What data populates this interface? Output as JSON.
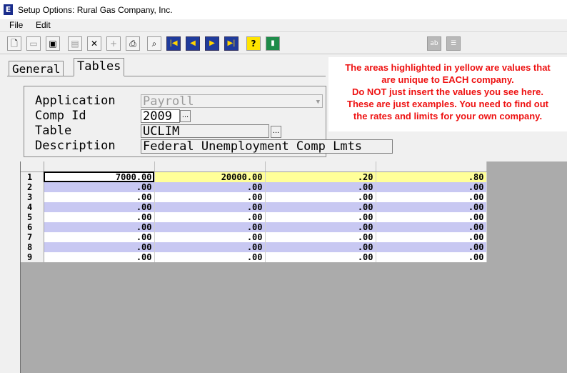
{
  "window": {
    "title": "Setup Options: Rural Gas Company, Inc.",
    "icon": "app-icon"
  },
  "menu": {
    "file": "File",
    "edit": "Edit"
  },
  "toolbar": {
    "buttons": [
      {
        "name": "new-icon",
        "glyph": "🗋"
      },
      {
        "name": "open-icon",
        "glyph": "📂"
      },
      {
        "name": "save-icon",
        "glyph": "💾"
      },
      {
        "name": "list-icon",
        "glyph": "▤"
      },
      {
        "name": "delete-icon",
        "glyph": "✕"
      },
      {
        "name": "add-icon",
        "glyph": "+"
      },
      {
        "name": "print-icon",
        "glyph": "⎙"
      },
      {
        "name": "find-icon",
        "glyph": "⌕"
      },
      {
        "name": "first-record-icon",
        "glyph": "|◀"
      },
      {
        "name": "previous-record-icon",
        "glyph": "◀"
      },
      {
        "name": "next-record-icon",
        "glyph": "▶"
      },
      {
        "name": "last-record-icon",
        "glyph": "▶|"
      },
      {
        "name": "help-icon",
        "glyph": "?"
      },
      {
        "name": "exit-icon",
        "glyph": "▮"
      },
      {
        "name": "abc-icon",
        "glyph": "ab"
      },
      {
        "name": "settings-icon",
        "glyph": "☰"
      }
    ]
  },
  "tabs": {
    "general": "General",
    "tables": "Tables"
  },
  "note": {
    "line1": "The areas highlighted in yellow are values that",
    "line2": "are unique to EACH company.",
    "line3": "Do NOT just insert the values you see here.",
    "line4": "These are just examples.  You need to find out",
    "line5": "the rates and limits for your own company."
  },
  "form": {
    "application_label": "Application",
    "application_value": "Payroll",
    "compid_label": "Comp Id",
    "compid_value": "2009",
    "table_label": "Table",
    "table_value": "UCLIM",
    "description_label": "Description",
    "description_value": "Federal Unemployment Comp Lmts",
    "ellipsis": "..."
  },
  "grid": {
    "rows": [
      {
        "num": "1",
        "c1": "7000.00",
        "c2": "20000.00",
        "c3": ".20",
        "c4": ".80"
      },
      {
        "num": "2",
        "c1": ".00",
        "c2": ".00",
        "c3": ".00",
        "c4": ".00"
      },
      {
        "num": "3",
        "c1": ".00",
        "c2": ".00",
        "c3": ".00",
        "c4": ".00"
      },
      {
        "num": "4",
        "c1": ".00",
        "c2": ".00",
        "c3": ".00",
        "c4": ".00"
      },
      {
        "num": "5",
        "c1": ".00",
        "c2": ".00",
        "c3": ".00",
        "c4": ".00"
      },
      {
        "num": "6",
        "c1": ".00",
        "c2": ".00",
        "c3": ".00",
        "c4": ".00"
      },
      {
        "num": "7",
        "c1": ".00",
        "c2": ".00",
        "c3": ".00",
        "c4": ".00"
      },
      {
        "num": "8",
        "c1": ".00",
        "c2": ".00",
        "c3": ".00",
        "c4": ".00"
      },
      {
        "num": "9",
        "c1": ".00",
        "c2": ".00",
        "c3": ".00",
        "c4": ".00"
      }
    ]
  },
  "colors": {
    "highlight": "#ffff99",
    "alt_row": "#c8c8f2",
    "note_red": "#ee1111"
  }
}
